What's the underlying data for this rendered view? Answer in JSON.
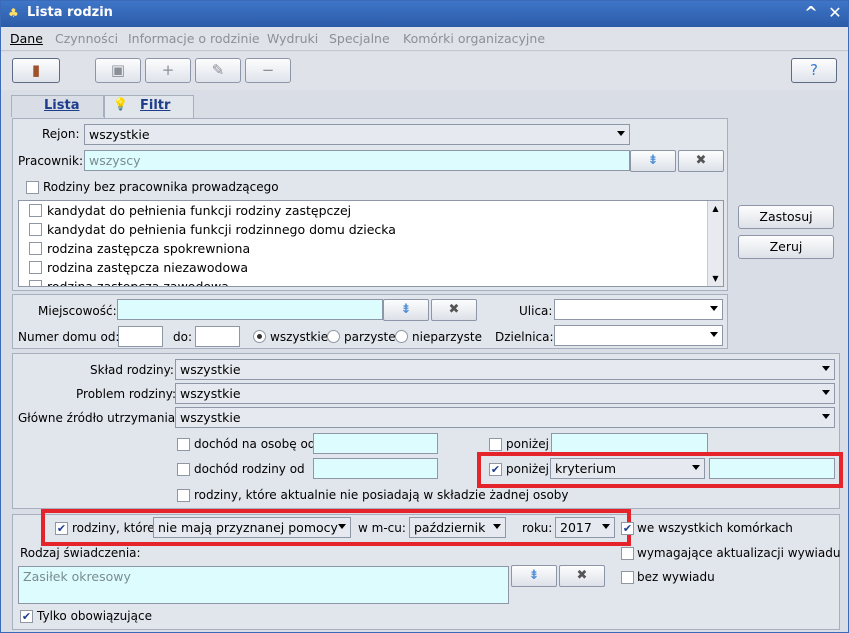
{
  "window": {
    "title": "Lista rodzin"
  },
  "menu": [
    "Dane",
    "Czynności",
    "Informacje o rodzinie",
    "Wydruki",
    "Specjalne",
    "Komórki organizacyjne"
  ],
  "tabs": {
    "lista": "Lista",
    "filtr": "Filtr"
  },
  "filter": {
    "rejon_label": "Rejon:",
    "rejon_value": "wszystkie",
    "pracownik_label": "Pracownik:",
    "pracownik_value": "wszyscy",
    "bez_pracownika": "Rodziny bez pracownika prowadzącego",
    "list_items": [
      "kandydat do pełnienia funkcji rodziny zastępczej",
      "kandydat do pełnienia funkcji rodzinnego domu dziecka",
      "rodzina zastępcza spokrewniona",
      "rodzina zastępcza niezawodowa",
      "rodzina zastępcza zawodowa"
    ]
  },
  "actions": {
    "zastosuj": "Zastosuj",
    "zeruj": "Zeruj"
  },
  "address": {
    "miejscowosc_label": "Miejscowość:",
    "ulica_label": "Ulica:",
    "numer_label": "Numer domu od:",
    "do_label": "do:",
    "radio_all": "wszystkie",
    "radio_even": "parzyste",
    "radio_odd": "nieparzyste",
    "dzielnica_label": "Dzielnica:"
  },
  "family": {
    "sklad_label": "Skład rodziny:",
    "sklad_value": "wszystkie",
    "problem_label": "Problem rodziny:",
    "problem_value": "wszystkie",
    "zrodlo_label": "Główne źródło utrzymania:",
    "zrodlo_value": "wszystkie",
    "dochod_osoba": "dochód na osobę od",
    "ponizej1": "poniżej",
    "dochod_rodziny": "dochód rodziny od",
    "ponizej2": "poniżej",
    "kryterium": "kryterium",
    "nie_posiadaja": "rodziny, które aktualnie nie posiadają w składzie żadnej osoby"
  },
  "aid": {
    "rodziny_ktore": "rodziny, które",
    "pomoc_value": "nie mają przyznanej pomocy",
    "wmcu": "w m-cu:",
    "miesiac": "październik",
    "roku": "roku:",
    "rok": "2017",
    "wszystkie_komorki": "we wszystkich komórkach",
    "rodzaj_label": "Rodzaj świadczenia:",
    "rodzaj_value": "Zasiłek okresowy",
    "aktualizacja": "wymagające aktualizacji wywiadu",
    "bez_wywiadu": "bez wywiadu",
    "tylko": "Tylko obowiązujące"
  },
  "colors": {
    "title_bar": "#2f64b4",
    "input_cyan": "#dcfcfd",
    "highlight": "#e5232a"
  }
}
